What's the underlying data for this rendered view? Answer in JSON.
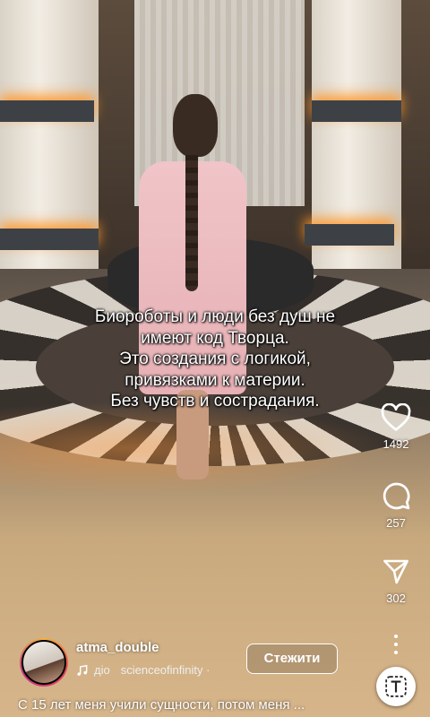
{
  "caption": {
    "lines": [
      "Биороботы и люди без душ не",
      "имеют код Творца.",
      "Это создания с логикой,",
      "привязками к материи.",
      "Без чувств и сострадания."
    ]
  },
  "actions": {
    "likes": {
      "icon": "heart-icon",
      "count": "1492"
    },
    "comments": {
      "icon": "comment-icon",
      "count": "257"
    },
    "shares": {
      "icon": "send-icon",
      "count": "302"
    }
  },
  "author": {
    "username": "atma_double",
    "follow_label": "Стежити",
    "audio_sub": "діо",
    "audio_source": "scienceofinfinity ·"
  },
  "description": "С 15 лет меня учили сущности, потом меня ...",
  "colors": {
    "text": "#ffffff",
    "follow_border": "#ffffff"
  }
}
